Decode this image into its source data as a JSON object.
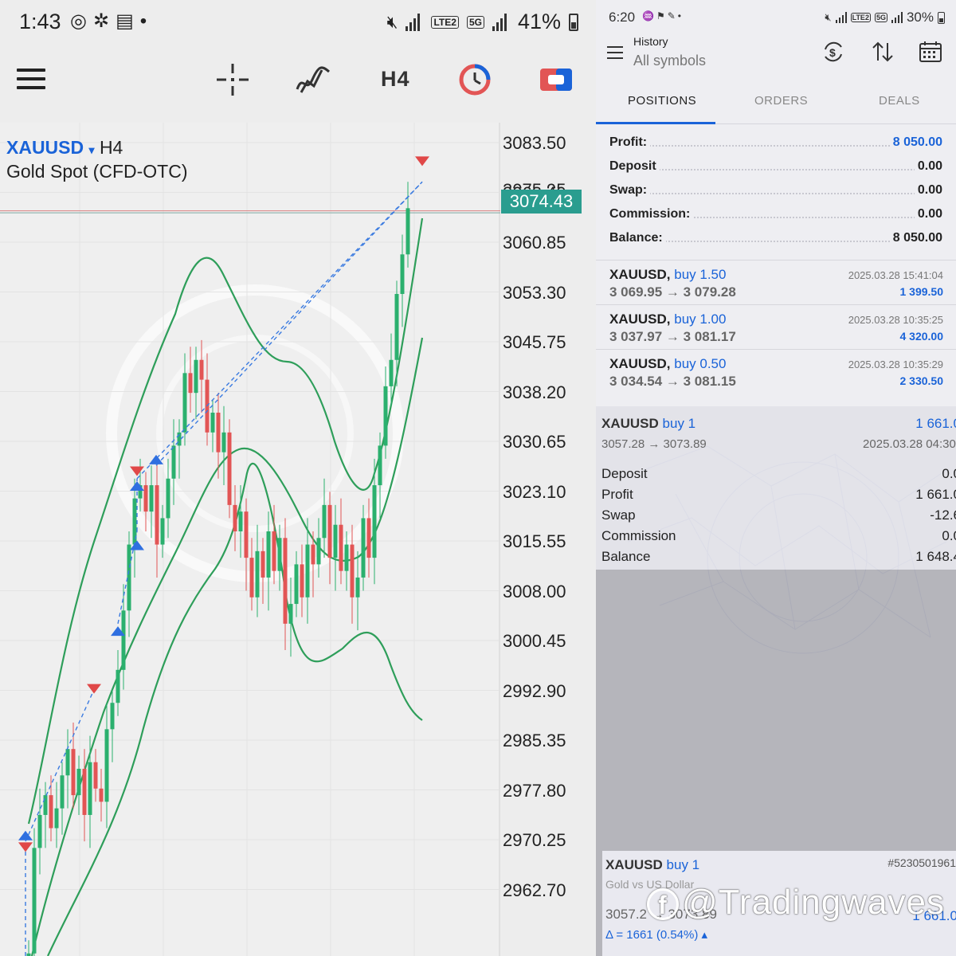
{
  "left_phone": {
    "status": {
      "time": "1:43",
      "battery": "41%"
    },
    "toolbar": {
      "timeframe": "H4"
    },
    "chart": {
      "symbol": "XAUUSD",
      "symbol_arrow": "▾",
      "timeframe": "H4",
      "description": "Gold  Spot (CFD-OTC)",
      "current_price": "3074.43",
      "hidden_label": "3075.95",
      "price_scale": [
        "3083.50",
        "3068.40",
        "3060.85",
        "3053.30",
        "3045.75",
        "3038.20",
        "3030.65",
        "3023.10",
        "3015.55",
        "3008.00",
        "3000.45",
        "2992.90",
        "2985.35",
        "2977.80",
        "2970.25",
        "2962.70"
      ],
      "colors": {
        "bull": "#2bb06e",
        "bear": "#e25555",
        "bollinger": "#2e9e5a",
        "trade_line": "#3b7be0",
        "price_tag": "#2a9d8f"
      }
    }
  },
  "right_phone": {
    "status": {
      "time": "6:20",
      "battery": "30%"
    },
    "header": {
      "title": "History",
      "subtitle": "All symbols"
    },
    "tabs": [
      {
        "label": "POSITIONS"
      },
      {
        "label": "ORDERS"
      },
      {
        "label": "DEALS"
      }
    ],
    "summary": [
      {
        "key": "Profit:",
        "value": "8 050.00"
      },
      {
        "key": "Deposit",
        "value": "0.00"
      },
      {
        "key": "Swap:",
        "value": "0.00"
      },
      {
        "key": "Commission:",
        "value": "0.00"
      },
      {
        "key": "Balance:",
        "value": "8 050.00"
      }
    ],
    "deals": [
      {
        "symbol": "XAUUSD,",
        "side": "buy 1.50",
        "prices": "3 069.95 → 3 079.28",
        "time": "2025.03.28 15:41:04",
        "profit": "1 399.50"
      },
      {
        "symbol": "XAUUSD,",
        "side": "buy 1.00",
        "prices": "3 037.97 → 3 081.17",
        "time": "2025.03.28 10:35:25",
        "profit": "4 320.00"
      },
      {
        "symbol": "XAUUSD,",
        "side": "buy 0.50",
        "prices": "3 034.54 → 3 081.15",
        "time": "2025.03.28 10:35:29",
        "profit": "2 330.50"
      }
    ],
    "detail": {
      "symbol": "XAUUSD",
      "side": "buy 1",
      "profit": "1 661.0",
      "prices": "3057.28 → 3073.89",
      "time": "2025.03.28 04:30:",
      "rows": [
        {
          "key": "Deposit",
          "value": "0.0"
        },
        {
          "key": "Profit",
          "value": "1 661.0"
        },
        {
          "key": "Swap",
          "value": "-12.6"
        },
        {
          "key": "Commission",
          "value": "0.0"
        },
        {
          "key": "Balance",
          "value": "1 648.4"
        }
      ]
    },
    "card": {
      "symbol": "XAUUSD",
      "side": "buy 1",
      "order_id": "#5230501961",
      "description": "Gold vs US Dollar",
      "prices": "3057.2",
      "prices_tail": "3073.89",
      "profit": "1 661.0",
      "delta": "Δ = 1661 (0.54%) ▴"
    },
    "watermark": "@Tradingwaves"
  }
}
